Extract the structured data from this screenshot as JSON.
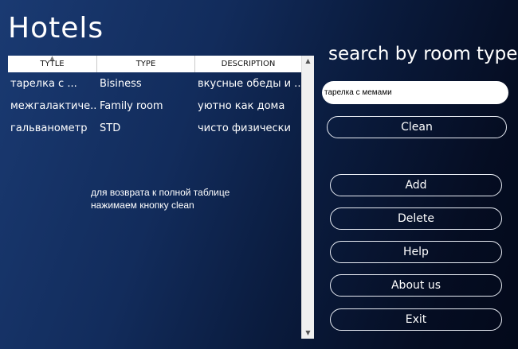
{
  "app": {
    "title": "Hotels"
  },
  "table": {
    "columns": [
      "TYTLE",
      "TYPE",
      "DESCRIPTION"
    ],
    "rows": [
      [
        "тарелка с ...",
        "Bisiness",
        "вкусные обеды и ..."
      ],
      [
        "межгалактиче...",
        "Family room",
        "уютно как дома"
      ],
      [
        "гальванометр",
        "STD",
        "чисто физически"
      ]
    ]
  },
  "hint": {
    "line1": "для возврата к полной таблице",
    "line2": "нажимаем кнопку clean"
  },
  "search": {
    "title": "search by room type",
    "value": "тарелка с мемами"
  },
  "buttons": {
    "clean": "Clean",
    "add": "Add",
    "delete": "Delete",
    "help": "Help",
    "about": "About us",
    "exit": "Exit"
  },
  "icons": {
    "sort": "sort-up-icon",
    "scroll_up": "scroll-up-icon",
    "scroll_down": "scroll-down-icon"
  }
}
